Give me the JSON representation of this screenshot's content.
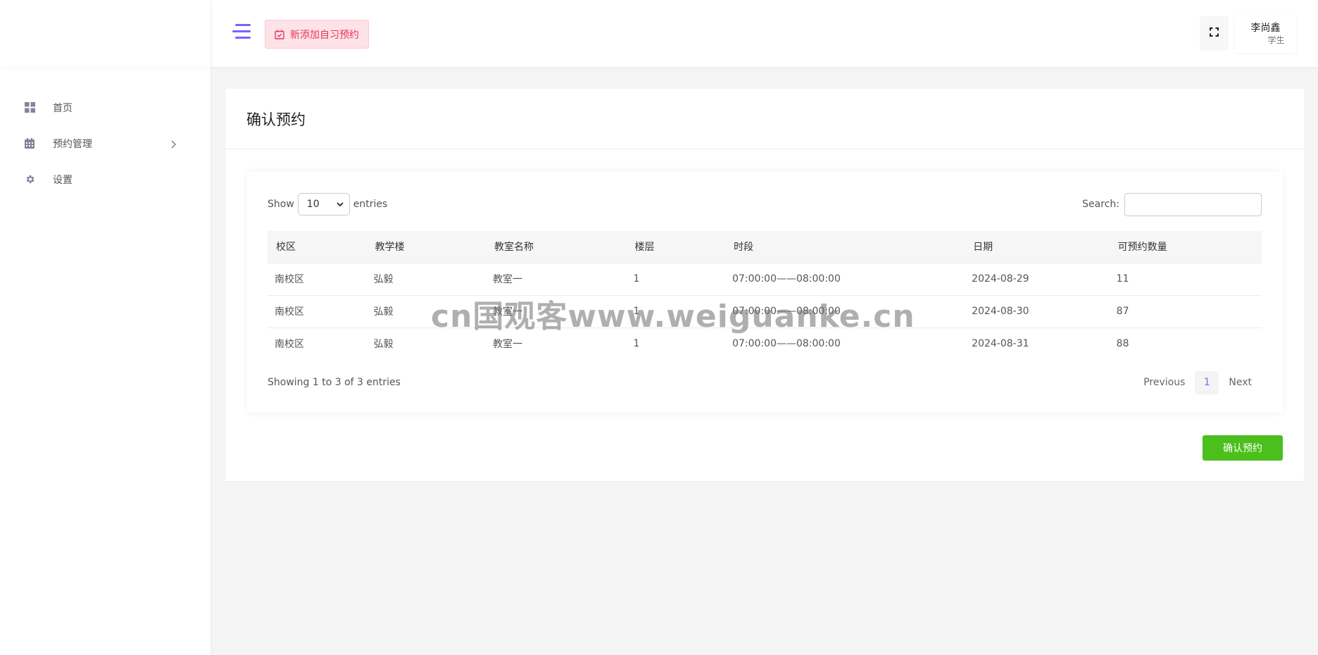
{
  "sidebar": {
    "items": [
      {
        "label": "首页",
        "icon": "dashboard-icon"
      },
      {
        "label": "预约管理",
        "icon": "calendar-icon"
      },
      {
        "label": "设置",
        "icon": "gear-icon"
      }
    ]
  },
  "header": {
    "add_button_label": "新添加自习预约",
    "user_name": "李尚鑫",
    "user_role": "学生"
  },
  "page": {
    "title": "确认预约"
  },
  "table_controls": {
    "show_label": "Show",
    "entries_label": "entries",
    "page_length": "10",
    "search_label": "Search:",
    "search_value": ""
  },
  "table": {
    "columns": [
      "校区",
      "教学楼",
      "教室名称",
      "楼层",
      "时段",
      "日期",
      "可预约数量"
    ],
    "rows": [
      [
        "南校区",
        "弘毅",
        "教室一",
        "1",
        "07:00:00——08:00:00",
        "2024-08-29",
        "11"
      ],
      [
        "南校区",
        "弘毅",
        "教室一",
        "1",
        "07:00:00——08:00:00",
        "2024-08-30",
        "87"
      ],
      [
        "南校区",
        "弘毅",
        "教室一",
        "1",
        "07:00:00——08:00:00",
        "2024-08-31",
        "88"
      ]
    ]
  },
  "pagination": {
    "info": "Showing 1 to 3 of 3 entries",
    "previous": "Previous",
    "current": "1",
    "next": "Next"
  },
  "actions": {
    "confirm_label": "确认预约"
  },
  "watermark": "cn国观客www.weiguanke.cn",
  "colors": {
    "accent": "#7b61ff",
    "add_button_bg": "#fde2e7",
    "add_button_text": "#e8365e",
    "confirm_button": "#4bbf1c"
  }
}
